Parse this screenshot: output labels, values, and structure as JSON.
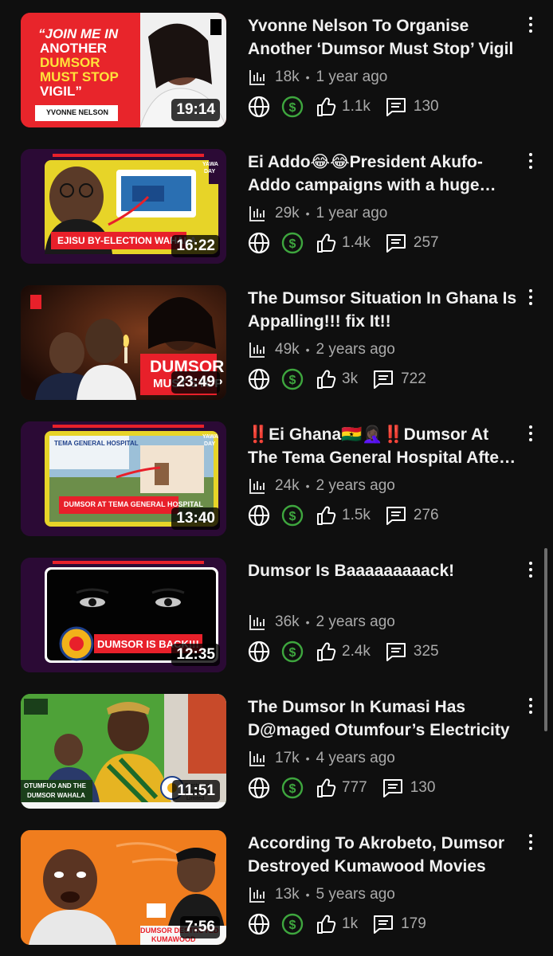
{
  "videos": [
    {
      "title": "Yvonne Nelson To Organise Another ‘Dumsor Must Stop’ Vigil",
      "views": "18k",
      "age": "1 year ago",
      "likes": "1.1k",
      "comments": "130",
      "duration": "19:14",
      "thumb_text": [
        "“JOIN ME IN",
        "ANOTHER",
        "DUMSOR",
        "MUST STOP",
        "VIGIL”",
        "YVONNE NELSON"
      ]
    },
    {
      "title": "Ei Addo😂😂President Akufo-Addo campaigns with a huge generator",
      "views": "29k",
      "age": "1 year ago",
      "likes": "1.4k",
      "comments": "257",
      "duration": "16:22",
      "thumb_text": [
        "EJISU BY-ELECTION WAHALA",
        "YAWA",
        "DAY"
      ]
    },
    {
      "title": "The Dumsor Situation In Ghana Is Appalling!!! fix It!!",
      "views": "49k",
      "age": "2 years ago",
      "likes": "3k",
      "comments": "722",
      "duration": "23:49",
      "thumb_text": [
        "DUMSOR",
        "MUST STOP"
      ]
    },
    {
      "title": "‼️Ei Ghana🇬🇭🤦🏿‍♀️‼️Dumsor At The Tema General Hospital After Power Cuts",
      "views": "24k",
      "age": "2 years ago",
      "likes": "1.5k",
      "comments": "276",
      "duration": "13:40",
      "thumb_text": [
        "TEMA GENERAL HOSPITAL",
        "DUMSOR AT TEMA GENERAL HOSPITAL",
        "YAWA",
        "DAY"
      ]
    },
    {
      "title": "Dumsor Is Baaaaaaaaack!",
      "views": "36k",
      "age": "2 years ago",
      "likes": "2.4k",
      "comments": "325",
      "duration": "12:35",
      "thumb_text": [
        "DUMSOR IS BACK!!!"
      ]
    },
    {
      "title": "The Dumsor In Kumasi Has D@maged Otumfour’s Electricity",
      "views": "17k",
      "age": "4 years ago",
      "likes": "777",
      "comments": "130",
      "duration": "11:51",
      "thumb_text": [
        "OTUMFUO AND THE",
        "DUMSOR WAHALA",
        "Electricity Company",
        "of Ghana Limited"
      ]
    },
    {
      "title": "According To Akrobeto, Dumsor Destroyed Kumawood Movies",
      "views": "13k",
      "age": "5 years ago",
      "likes": "1k",
      "comments": "179",
      "duration": "7:56",
      "thumb_text": [
        "DUMSOR DESTROYED",
        "KUMAWOOD"
      ]
    }
  ],
  "colors": {
    "background": "#0f0f0f",
    "secondary_text": "#aaaaaa",
    "monetized_icon": "#3ea63e",
    "accent_red": "#e8202a"
  },
  "icons": {
    "views": "bar-chart-icon",
    "visibility": "globe-icon",
    "monetization": "dollar-icon",
    "likes": "thumb-up-icon",
    "comments": "comment-icon",
    "menu": "more-vert-icon"
  }
}
